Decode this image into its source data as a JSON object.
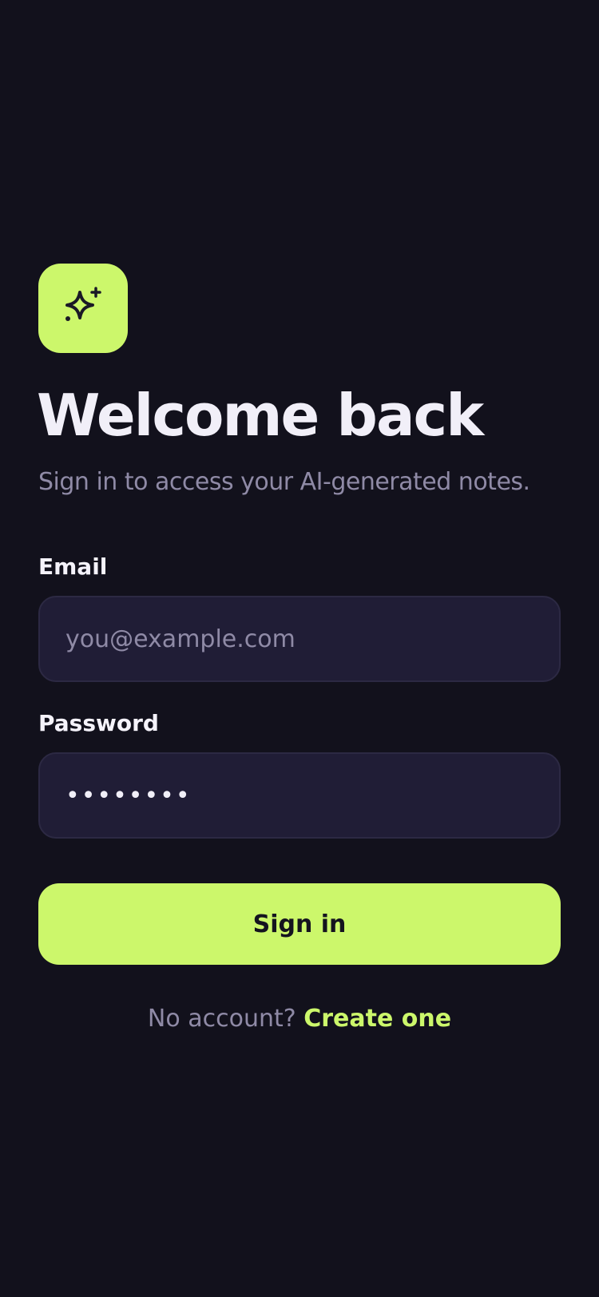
{
  "logo": {
    "icon": "sparkles-icon",
    "color": "#ccf76b"
  },
  "header": {
    "title": "Welcome back",
    "subtitle": "Sign in to access your AI-generated notes."
  },
  "form": {
    "email": {
      "label": "Email",
      "placeholder": "you@example.com",
      "value": ""
    },
    "password": {
      "label": "Password",
      "value": "••••••••"
    },
    "submit_label": "Sign in"
  },
  "footer": {
    "prompt": "No account?",
    "link_label": "Create one"
  },
  "colors": {
    "background": "#12111c",
    "accent": "#ccf76b",
    "input_bg": "#201d36",
    "muted_text": "#8f8aa6"
  }
}
